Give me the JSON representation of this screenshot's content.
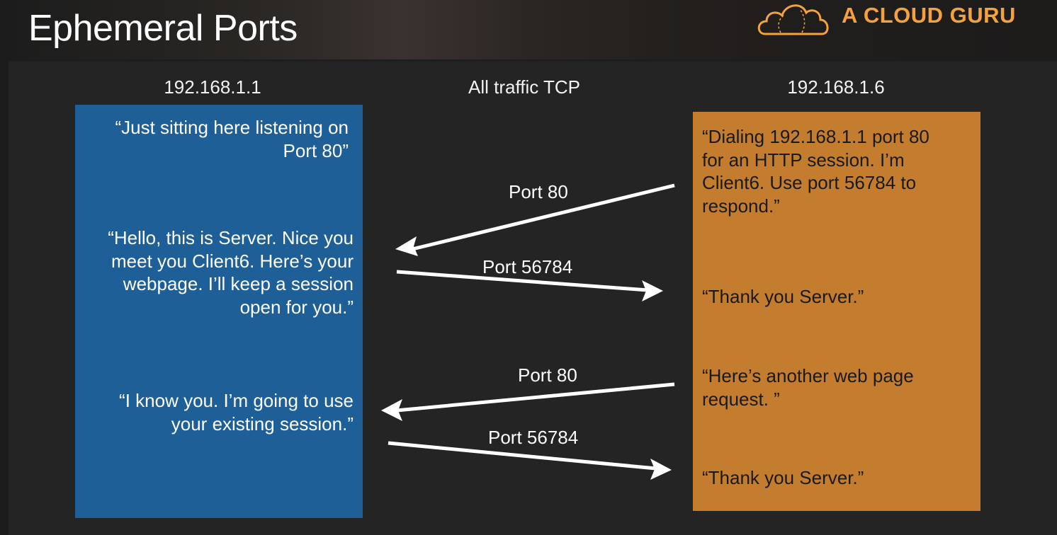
{
  "header": {
    "title": "Ephemeral Ports",
    "brand": "A CLOUD GURU",
    "brand_color": "#f3a23f",
    "brand_icon": "cloud-icon"
  },
  "diagram": {
    "left_host": "192.168.1.1",
    "center_label": "All traffic TCP",
    "right_host": "192.168.1.6",
    "server_color": "#1f5f98",
    "client_color": "#c47d2e",
    "server_messages": [
      "“Just sitting here listening on\nPort 80”",
      "“Hello, this is Server.  Nice you\nmeet you Client6.  Here’s your\nwebpage.  I’ll keep a session\nopen for you.”",
      "“I know you.  I’m going to use\nyour existing session.”"
    ],
    "client_messages": [
      "“Dialing 192.168.1.1 port 80\nfor an HTTP session.  I’m\nClient6.  Use port 56784 to\nrespond.”",
      "“Thank you Server.”",
      "“Here’s another web page\nrequest. ”",
      "“Thank you Server.”"
    ],
    "arrows": [
      {
        "label": "Port 80",
        "direction": "to-server"
      },
      {
        "label": "Port 56784",
        "direction": "to-client"
      },
      {
        "label": "Port 80",
        "direction": "to-server"
      },
      {
        "label": "Port 56784",
        "direction": "to-client"
      }
    ]
  }
}
